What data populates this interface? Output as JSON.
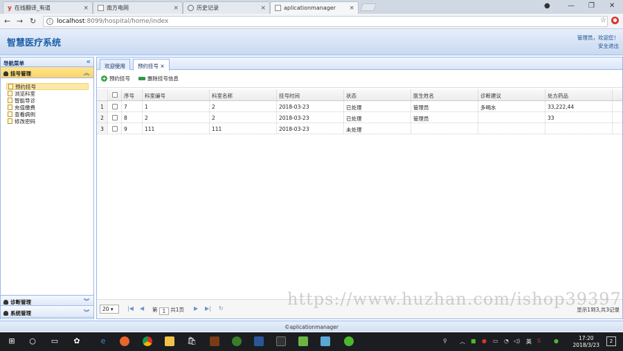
{
  "browser": {
    "tabs": [
      {
        "label": "在线翻译_有道",
        "icon": "youdao-icon"
      },
      {
        "label": "南方电网",
        "icon": "page-icon"
      },
      {
        "label": "历史记录",
        "icon": "history-icon"
      },
      {
        "label": "aplicationmanager",
        "icon": "page-icon"
      }
    ],
    "url_host": "localhost",
    "url_path": ":8099/hospital/home/index"
  },
  "header": {
    "title": "智慧医疗系统",
    "user_line": "管理员，欢迎您！",
    "logout": "安全退出"
  },
  "sidebar": {
    "title": "导航菜单",
    "groups": [
      {
        "label": "挂号管理"
      },
      {
        "label": "诊断管理"
      },
      {
        "label": "系统管理"
      }
    ],
    "items": [
      {
        "label": "预约挂号"
      },
      {
        "label": "浏览科室"
      },
      {
        "label": "智能导诊"
      },
      {
        "label": "充值缴费"
      },
      {
        "label": "查看病例"
      },
      {
        "label": "修改密码"
      }
    ]
  },
  "main": {
    "tabs": [
      {
        "label": "欢迎使用"
      },
      {
        "label": "预约挂号"
      }
    ],
    "toolbar": {
      "add": "预约挂号",
      "delete": "删除挂号信息"
    },
    "grid": {
      "columns": [
        "序号",
        "科室编号",
        "科室名称",
        "挂号时间",
        "状态",
        "医生姓名",
        "诊断建议",
        "处方药品"
      ],
      "rows": [
        {
          "rn": "1",
          "cells": [
            "7",
            "1",
            "2",
            "2018-03-23",
            "已处理",
            "管理员",
            "多喝水",
            "33,222,44"
          ]
        },
        {
          "rn": "2",
          "cells": [
            "8",
            "2",
            "2",
            "2018-03-23",
            "已处理",
            "管理员",
            "",
            "33"
          ]
        },
        {
          "rn": "3",
          "cells": [
            "9",
            "111",
            "111",
            "2018-03-23",
            "未处理",
            "",
            "",
            ""
          ]
        }
      ]
    },
    "pager": {
      "page_size": "20",
      "page_prefix": "第",
      "page_value": "1",
      "page_suffix": "共1页",
      "summary": "显示1到3,共3记录"
    }
  },
  "footer": {
    "text": "©aplicationmanager"
  },
  "watermark": "https://www.huzhan.com/ishop39397",
  "taskbar": {
    "ime": "英",
    "time": "17:20",
    "date": "2018/3/23",
    "notif_count": "2"
  }
}
